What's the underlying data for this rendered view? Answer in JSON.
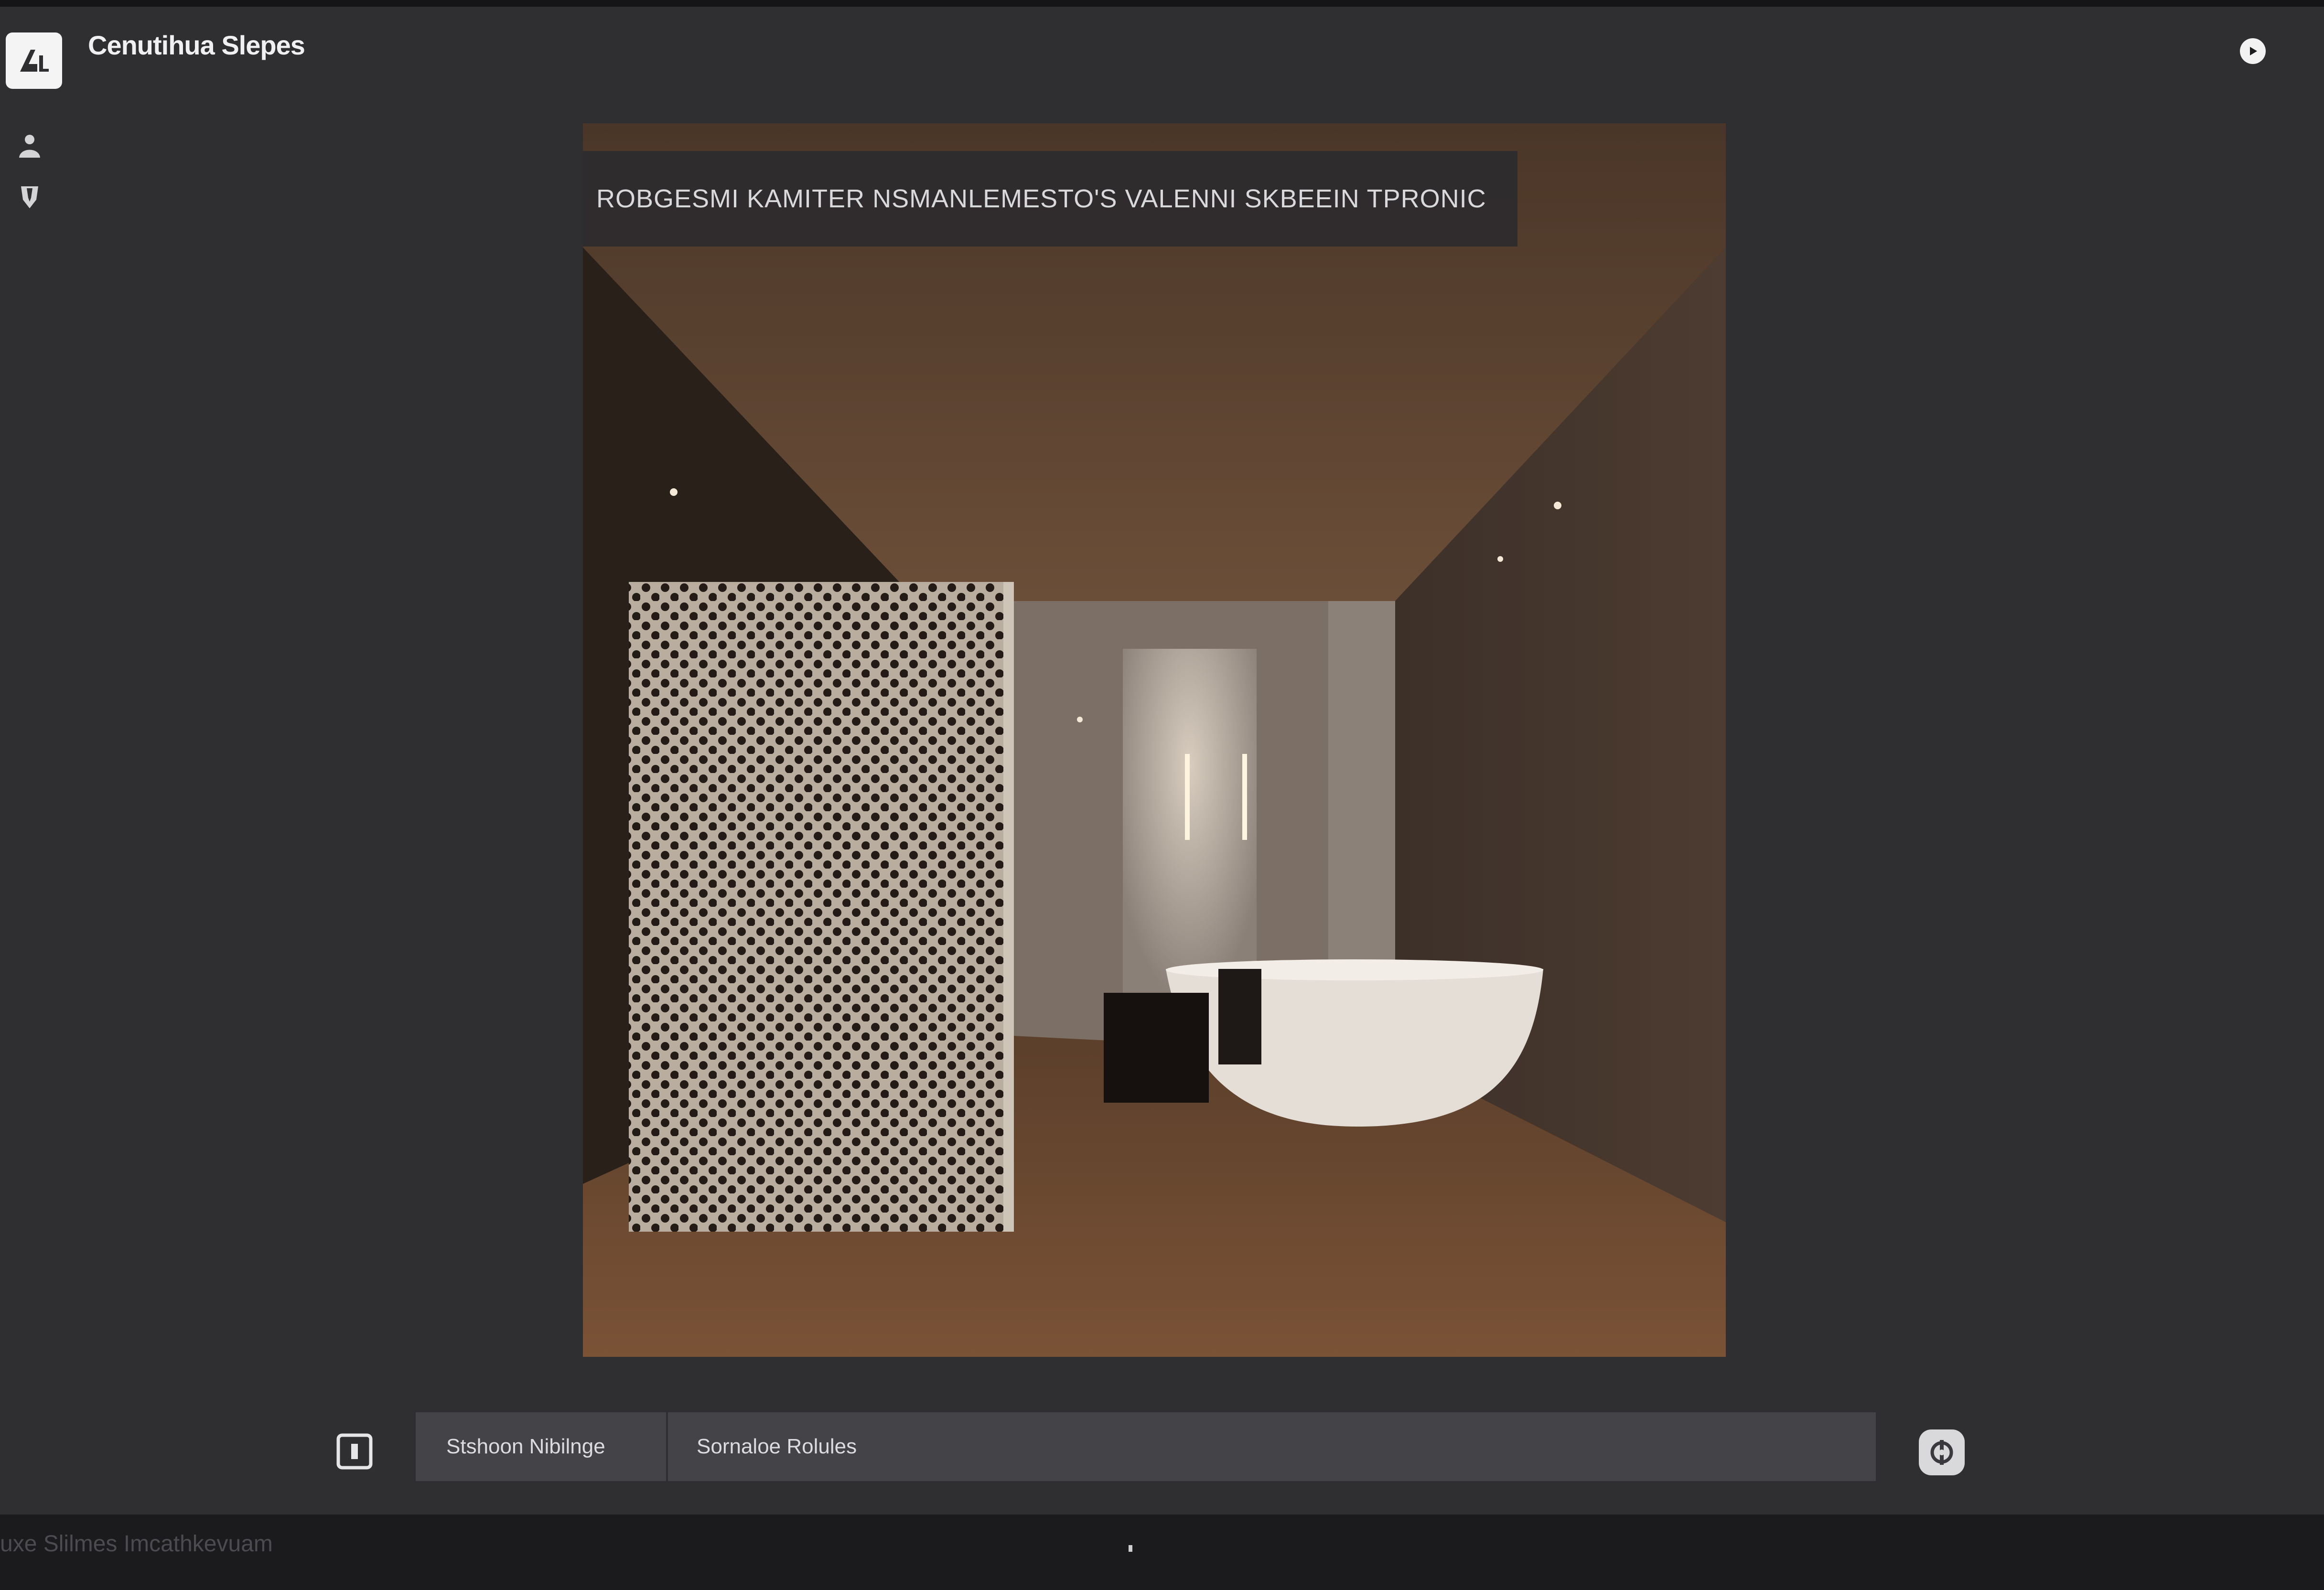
{
  "app": {
    "title": "Cenutihua Slepes"
  },
  "viewer": {
    "banner_text": "ROBGESMI KAMITER NSMANLEMESTO'S VALENNI SKBEEIN TPRONIC"
  },
  "bottom_bar": {
    "field_a_value": "Stshoon Nibilnge",
    "field_b_value": "Sornaloe Rolules"
  },
  "status_bar": {
    "text": "uxe Slilmes Imcathkevuam"
  },
  "icons": {
    "app": "app-logo-icon",
    "side_1": "person-icon",
    "side_2": "shield-icon",
    "play": "play-icon",
    "frame": "frame-icon",
    "settings": "settings-icon"
  },
  "colors": {
    "background": "#2f2f32",
    "field": "#444448",
    "statusbar": "#1b1b1d"
  }
}
